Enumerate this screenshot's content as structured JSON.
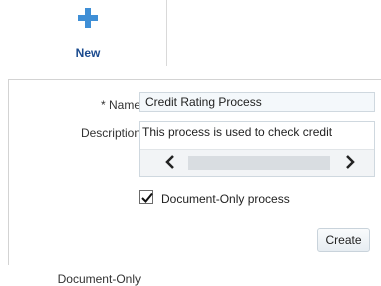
{
  "toolbar": {
    "new_label": "New",
    "new_icon": "plus-icon"
  },
  "form": {
    "name_label": "* Name",
    "name_value": "Credit Rating Process",
    "description_label": "Description",
    "description_value": "This process is used to check credit",
    "document_only_label": "Document-Only",
    "document_only_checked": true,
    "document_only_checkbox_label": "Document-Only process",
    "create_label": "Create"
  },
  "colors": {
    "accent": "#3f8fd6",
    "new_label": "#1b4b8f"
  }
}
